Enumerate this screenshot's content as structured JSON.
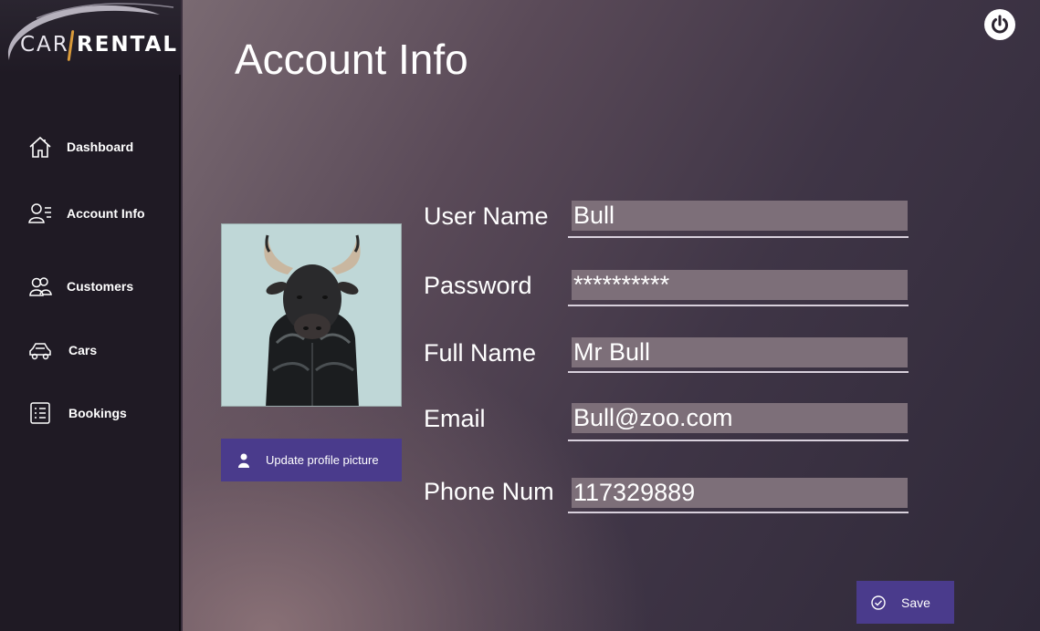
{
  "app": {
    "logo_left": "CAR",
    "logo_right": "RENTAL"
  },
  "sidebar": {
    "items": [
      {
        "label": "Dashboard",
        "icon": "home-icon"
      },
      {
        "label": "Account Info",
        "icon": "user-list-icon"
      },
      {
        "label": "Customers",
        "icon": "users-icon"
      },
      {
        "label": "Cars",
        "icon": "car-icon"
      },
      {
        "label": "Bookings",
        "icon": "list-icon"
      }
    ]
  },
  "page": {
    "title": "Account Info"
  },
  "profile": {
    "update_label": "Update profile picture"
  },
  "form": {
    "username_label": "User Name",
    "username_value": "Bull",
    "password_label": "Password",
    "password_value": "**********",
    "fullname_label": "Full Name",
    "fullname_value": "Mr Bull",
    "email_label": "Email",
    "email_value": "Bull@zoo.com",
    "phone_label": "Phone Num",
    "phone_value": "117329889"
  },
  "actions": {
    "save_label": "Save"
  },
  "colors": {
    "sidebar_bg": "#1f1a24",
    "accent": "#4a3b8c",
    "field_bg": "#7d6f79"
  }
}
